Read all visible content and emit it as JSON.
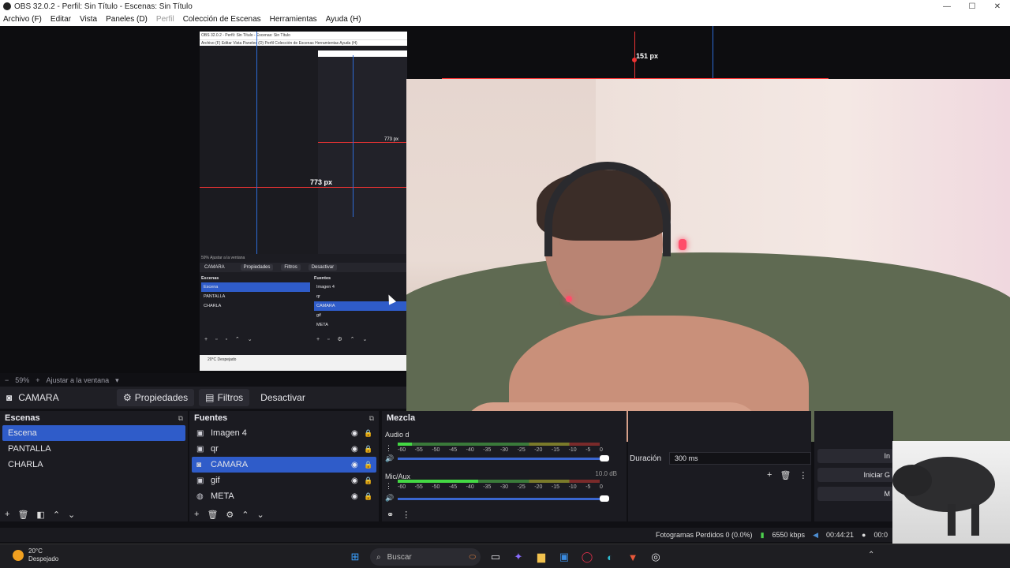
{
  "titlebar": {
    "title": "OBS 32.0.2 - Perfil: Sin Título - Escenas: Sin Título"
  },
  "menu": [
    {
      "label": "Archivo (F)",
      "disabled": false
    },
    {
      "label": "Editar",
      "disabled": false
    },
    {
      "label": "Vista",
      "disabled": false
    },
    {
      "label": "Paneles (D)",
      "disabled": false
    },
    {
      "label": "Perfil",
      "disabled": true
    },
    {
      "label": "Colección de Escenas",
      "disabled": false
    },
    {
      "label": "Herramientas",
      "disabled": false
    },
    {
      "label": "Ayuda (H)",
      "disabled": false
    }
  ],
  "nested_preview": {
    "title": "OBS 32.0.2 - Perfil: Sin Título - Escenas: Sin Título",
    "menu": "Archivo (F)   Editar   Vista   Paneles (D)   Perfil   Colección de Escenas   Herramientas   Ayuda (H)",
    "measure_label": "773 px",
    "measure_label_small": "773 px",
    "zoom": "59%   Ajustar a la ventana",
    "source": "CAMARA",
    "buttons": [
      "Propiedades",
      "Filtros",
      "Desactivar"
    ],
    "scenes_header": "Escenas",
    "scenes": [
      "Escena",
      "PANTALLA",
      "CHARLA"
    ],
    "sources_header": "Fuentes",
    "sources": [
      "Imagen 4",
      "qr",
      "CAMARA",
      "gif",
      "META"
    ],
    "weather": "20°C Despejado"
  },
  "preview": {
    "measure_label": "151 px"
  },
  "zoombar": {
    "zoom_value": "59%",
    "fit_label": "Ajustar a la ventana"
  },
  "context": {
    "source_name": "CAMARA",
    "properties": "Propiedades",
    "filters": "Filtros",
    "deactivate": "Desactivar"
  },
  "scenes": {
    "header": "Escenas",
    "items": [
      {
        "label": "Escena",
        "selected": true
      },
      {
        "label": "PANTALLA",
        "selected": false
      },
      {
        "label": "CHARLA",
        "selected": false
      }
    ]
  },
  "sources": {
    "header": "Fuentes",
    "items": [
      {
        "label": "Imagen 4",
        "icon": "image-icon",
        "selected": false
      },
      {
        "label": "qr",
        "icon": "image-icon",
        "selected": false
      },
      {
        "label": "CAMARA",
        "icon": "camera-icon",
        "selected": true
      },
      {
        "label": "gif",
        "icon": "image-icon",
        "selected": false
      },
      {
        "label": "META",
        "icon": "globe-icon",
        "selected": false
      }
    ]
  },
  "mixer": {
    "header": "Mezcla",
    "channels": [
      {
        "name": "Audio d",
        "db": "",
        "level": 0.07
      },
      {
        "name": "Mic/Aux",
        "db": "10.0 dB",
        "level": 0.4
      }
    ],
    "scale": [
      "-60",
      "-55",
      "-50",
      "-45",
      "-40",
      "-35",
      "-30",
      "-25",
      "-20",
      "-15",
      "-10",
      "-5",
      "0"
    ]
  },
  "transitions": {
    "duration_label": "Duración",
    "duration_value": "300 ms"
  },
  "controls": {
    "items": [
      "In",
      "Iniciar G",
      "M"
    ]
  },
  "status": {
    "dropped": "Fotogramas Perdidos 0 (0.0%)",
    "bitrate": "6550 kbps",
    "stream_time": "00:44:21",
    "rec_time": "00:0"
  },
  "taskbar": {
    "temp": "20°C",
    "weather": "Despejado",
    "search_placeholder": "Buscar"
  }
}
